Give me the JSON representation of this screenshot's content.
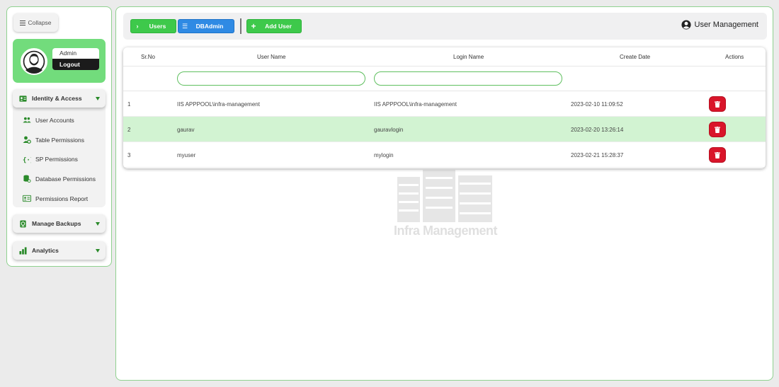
{
  "sidebar": {
    "collapse_label": "Collapse",
    "profile": {
      "name": "Admin",
      "logout_label": "Logout"
    },
    "groups": [
      {
        "label": "Identity & Access",
        "icon": "id-card-icon",
        "items": [
          {
            "label": "User Accounts",
            "icon": "users-icon"
          },
          {
            "label": "Table Permissions",
            "icon": "user-gear-icon"
          },
          {
            "label": "SP Permissions",
            "icon": "braces-icon"
          },
          {
            "label": "Database Permissions",
            "icon": "database-icon"
          },
          {
            "label": "Permissions Report",
            "icon": "report-icon"
          }
        ]
      },
      {
        "label": "Manage Backups",
        "icon": "backup-icon"
      },
      {
        "label": "Analytics",
        "icon": "bar-chart-icon"
      }
    ]
  },
  "toolbar": {
    "users_label": "Users",
    "dbadmin_label": "DBAdmin",
    "add_user_label": "Add User",
    "page_title": "User Management"
  },
  "table": {
    "columns": [
      "Sr.No",
      "User Name",
      "Login Name",
      "Create Date",
      "Actions"
    ],
    "filters": {
      "username": "",
      "loginname": ""
    },
    "rows": [
      {
        "srno": "1",
        "username": "IIS APPPOOL\\infra-management",
        "loginname": "IIS APPPOOL\\infra-management",
        "created": "2023-02-10 11:09:52"
      },
      {
        "srno": "2",
        "username": "gaurav",
        "loginname": "gauravlogin",
        "created": "2023-02-20 13:26:14",
        "selected": true
      },
      {
        "srno": "3",
        "username": "myuser",
        "loginname": "mylogin",
        "created": "2023-02-21 15:28:37"
      }
    ]
  },
  "watermark": {
    "text": "Infra Management"
  },
  "colors": {
    "green": "#3ec94b",
    "blue": "#2f8ae4",
    "danger": "#d9152a",
    "selected_row": "#d2f3d2",
    "profile_bg": "#72dc7c"
  }
}
